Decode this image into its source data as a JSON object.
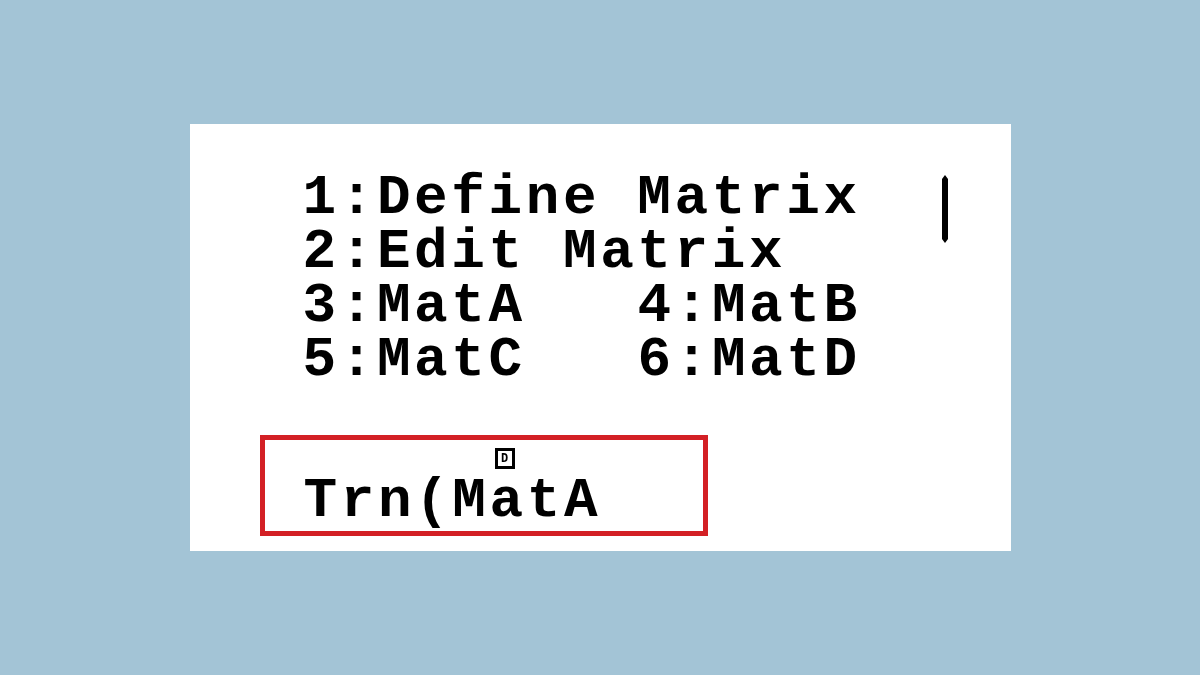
{
  "menu": {
    "rows": [
      [
        "1:Define Matrix"
      ],
      [
        "2:Edit Matrix"
      ],
      [
        "3:MatA",
        "4:MatB"
      ],
      [
        "5:MatC",
        "6:MatD"
      ]
    ]
  },
  "entry": {
    "indicator": "D",
    "expression": "Trn(MatA"
  }
}
